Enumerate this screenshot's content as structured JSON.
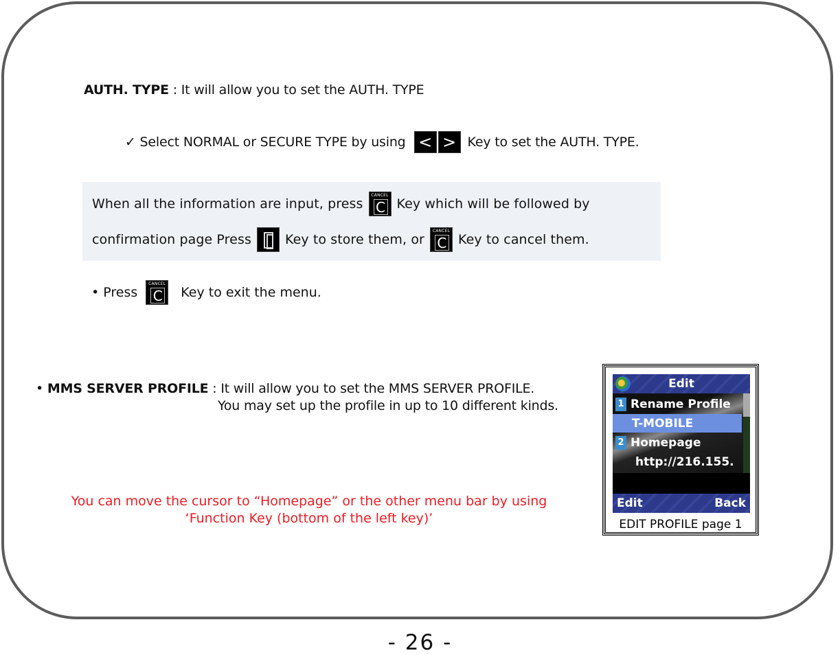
{
  "auth_type": {
    "label": "AUTH. TYPE",
    "description": " : It will allow you to set the AUTH. TYPE"
  },
  "select_instruction": {
    "prefix": "✓ Select NORMAL or SECURE TYPE by using",
    "left_key": "<",
    "right_key": ">",
    "suffix": "Key to set the AUTH. TYPE."
  },
  "info_box": {
    "line1_prefix": "When all the information are input, press",
    "line1_suffix": "Key which will be followed by",
    "line2_prefix": "confirmation page Press",
    "line2_middle": "Key to store them, or",
    "line2_suffix": "Key to cancel them."
  },
  "cancel_key": {
    "label": "CANCEL",
    "glyph": "C"
  },
  "press_exit": {
    "prefix": "• Press",
    "suffix": "Key to exit the menu."
  },
  "mms_profile": {
    "bullet": "• ",
    "label": "MMS SERVER PROFILE",
    "line1": " :  It will allow you to set the MMS SERVER PROFILE.",
    "line2": "You may set up the profile in up to 10 different kinds."
  },
  "red_note": {
    "line1": "You can move the cursor to “Homepage” or the other menu bar by using",
    "line2": "‘Function Key (bottom of the left key)’",
    "color": "#ee1c24"
  },
  "phone_screen": {
    "title": "Edit",
    "items": [
      {
        "number": "1",
        "label": "Rename Profile",
        "value": "T-MOBILE"
      },
      {
        "number": "2",
        "label": "Homepage",
        "value": "http://216.155."
      }
    ],
    "soft_left": "Edit",
    "soft_right": "Back",
    "caption": "EDIT PROFILE page 1",
    "highlight_color": "#6c8fe0"
  },
  "page_number": "- 26 -"
}
